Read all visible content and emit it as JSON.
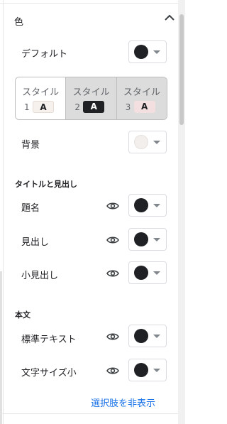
{
  "section": {
    "title": "色"
  },
  "rows": {
    "default": {
      "label": "デフォルト"
    },
    "background": {
      "label": "背景"
    },
    "title": {
      "label": "題名"
    },
    "heading": {
      "label": "見出し"
    },
    "subheading": {
      "label": "小見出し"
    },
    "normal_text": {
      "label": "標準テキスト"
    },
    "small_text": {
      "label": "文字サイズ小"
    }
  },
  "groups": {
    "titles": "タイトルと見出し",
    "body": "本文"
  },
  "style_options": [
    {
      "label": "スタイル",
      "number": "1",
      "badge": "A",
      "selected": true
    },
    {
      "label": "スタイル",
      "number": "2",
      "badge": "A",
      "selected": false
    },
    {
      "label": "スタイル",
      "number": "3",
      "badge": "A",
      "selected": false
    }
  ],
  "link": {
    "hide_options": "選択肢を非表示"
  },
  "colors": {
    "swatch_dark": "#202124",
    "swatch_background": "#f3efec",
    "link": "#1a73e8"
  },
  "icons": {
    "collapse": "chevron-up-icon",
    "visibility": "eye-icon",
    "dropdown": "caret-down-icon"
  }
}
